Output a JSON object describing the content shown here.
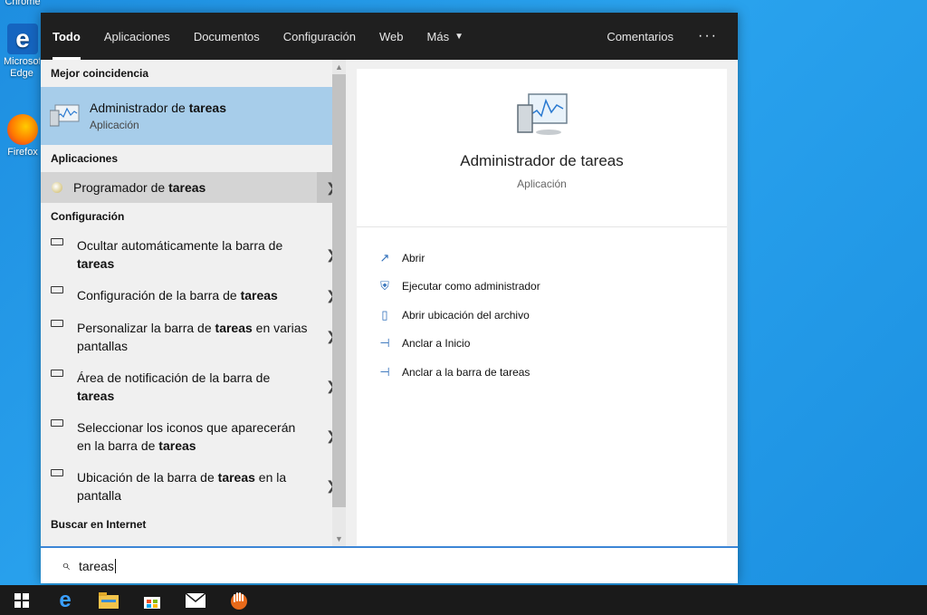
{
  "desktop": {
    "top_label": "Chrome",
    "edge_label": "Microsoft Edge",
    "firefox_label": "Firefox"
  },
  "tabs": [
    {
      "label": "Todo",
      "active": true
    },
    {
      "label": "Aplicaciones"
    },
    {
      "label": "Documentos"
    },
    {
      "label": "Configuración"
    },
    {
      "label": "Web"
    },
    {
      "label": "Más"
    }
  ],
  "header": {
    "feedback_label": "Comentarios",
    "more_label": "···"
  },
  "left": {
    "best_match_header": "Mejor coincidencia",
    "best_match": {
      "title_pre": "Administrador de ",
      "title_bold": "tareas",
      "subtitle": "Aplicación"
    },
    "apps_header": "Aplicaciones",
    "app_item": {
      "pre": "Programador de ",
      "bold": "tareas"
    },
    "settings_header": "Configuración",
    "settings": [
      {
        "pre": "Ocultar automáticamente la barra de ",
        "bold": "tareas",
        "post": ""
      },
      {
        "pre": "Configuración de la barra de ",
        "bold": "tareas",
        "post": ""
      },
      {
        "pre": "Personalizar la barra de ",
        "bold": "tareas",
        "post": " en varias pantallas"
      },
      {
        "pre": "Área de notificación de la barra de ",
        "bold": "tareas",
        "post": ""
      },
      {
        "pre": "Seleccionar los iconos que aparecerán en la barra de ",
        "bold": "tareas",
        "post": ""
      },
      {
        "pre": "Ubicación de la barra de ",
        "bold": "tareas",
        "post": " en la pantalla"
      }
    ],
    "web_header": "Buscar en Internet"
  },
  "detail": {
    "title": "Administrador de tareas",
    "subtitle": "Aplicación",
    "actions": [
      {
        "label": "Abrir",
        "icon": "open-icon"
      },
      {
        "label": "Ejecutar como administrador",
        "icon": "shield-icon"
      },
      {
        "label": "Abrir ubicación del archivo",
        "icon": "file-location-icon"
      },
      {
        "label": "Anclar a Inicio",
        "icon": "pin-icon"
      },
      {
        "label": "Anclar a la barra de tareas",
        "icon": "pin-icon"
      }
    ]
  },
  "search": {
    "value": "tareas"
  },
  "taskbar": [
    "windows-start-icon",
    "edge-icon",
    "file-explorer-icon",
    "store-icon",
    "mail-icon",
    "app-icon"
  ],
  "colors": {
    "accent": "#3c86d6",
    "selection": "#a7cdea",
    "topbar": "#1f1f1f"
  }
}
